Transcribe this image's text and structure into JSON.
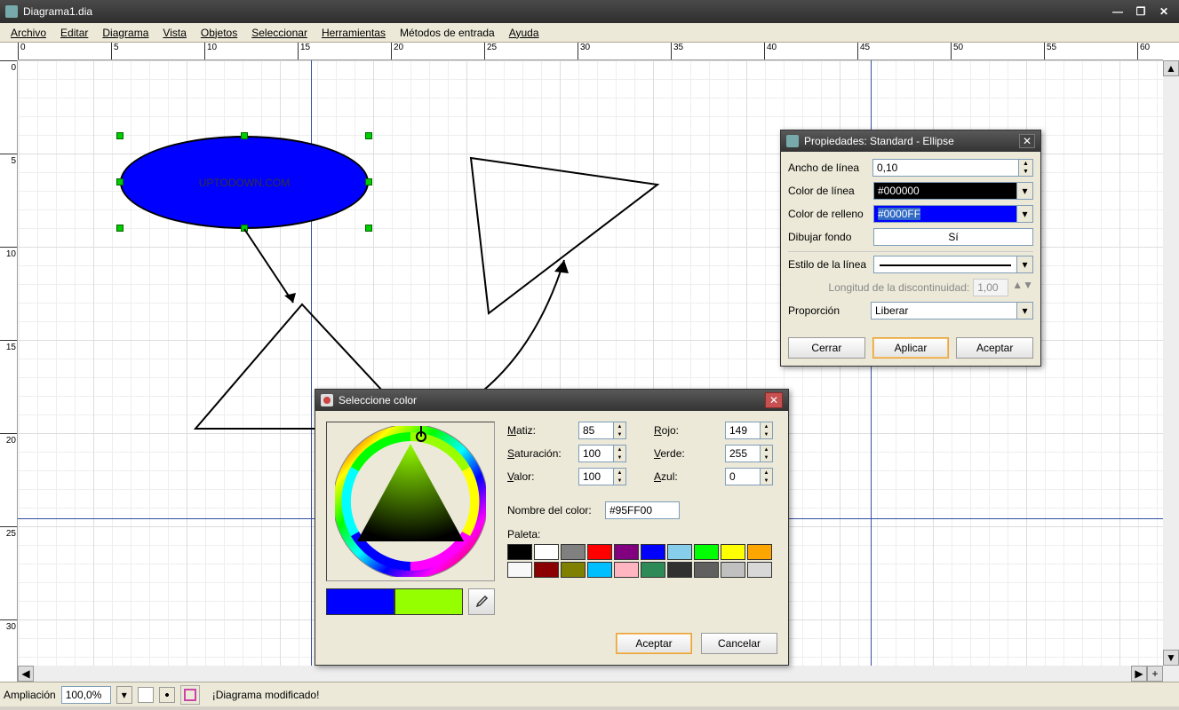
{
  "window": {
    "title": "Diagrama1.dia"
  },
  "menu": {
    "archivo": "Archivo",
    "editar": "Editar",
    "diagrama": "Diagrama",
    "vista": "Vista",
    "objetos": "Objetos",
    "seleccionar": "Seleccionar",
    "herramientas": "Herramientas",
    "metodos": "Métodos de entrada",
    "ayuda": "Ayuda"
  },
  "ruler_h": [
    "0",
    "5",
    "10",
    "15",
    "20",
    "25",
    "30",
    "35",
    "40",
    "45",
    "50",
    "55",
    "60"
  ],
  "ruler_v": [
    "0",
    "5",
    "10",
    "15",
    "20",
    "25",
    "30"
  ],
  "canvas": {
    "ellipse_text": "UPTODOWN.COM"
  },
  "status": {
    "zoom_label": "Ampliación",
    "zoom_value": "100,0%",
    "message": "¡Diagrama modificado!"
  },
  "props": {
    "title": "Propiedades: Standard - Ellipse",
    "rows": {
      "ancho_label": "Ancho de línea",
      "ancho_value": "0,10",
      "color_linea_label": "Color de línea",
      "color_linea_value": "#000000",
      "color_relleno_label": "Color de relleno",
      "color_relleno_value": "#0000FF",
      "dibujar_fondo_label": "Dibujar fondo",
      "dibujar_fondo_value": "Sí",
      "estilo_label": "Estilo de la línea",
      "longitud_label": "Longitud de la discontinuidad:",
      "longitud_value": "1,00",
      "proporcion_label": "Proporción",
      "proporcion_value": "Liberar"
    },
    "buttons": {
      "cerrar": "Cerrar",
      "aplicar": "Aplicar",
      "aceptar": "Aceptar"
    }
  },
  "color": {
    "title": "Seleccione color",
    "labels": {
      "matiz": "Matiz:",
      "saturacion": "Saturación:",
      "valor": "Valor:",
      "rojo": "Rojo:",
      "verde": "Verde:",
      "azul": "Azul:",
      "nombre": "Nombre del color:",
      "paleta": "Paleta:"
    },
    "values": {
      "matiz": "85",
      "saturacion": "100",
      "valor": "100",
      "rojo": "149",
      "verde": "255",
      "azul": "0",
      "nombre": "#95FF00"
    },
    "swatches": {
      "old": "#0000FF",
      "new": "#95FF00"
    },
    "palette": [
      "#000000",
      "#FFFFFF",
      "#808080",
      "#FF0000",
      "#800080",
      "#0000FF",
      "#87CEEB",
      "#00FF00",
      "#FFFF00",
      "#FFA500",
      "#F8F8F8",
      "#8B0000",
      "#808000",
      "#00BFFF",
      "#FFB6C1",
      "#2E8B57",
      "#303030",
      "#606060",
      "#C0C0C0",
      "#D8D8D8"
    ],
    "buttons": {
      "aceptar": "Aceptar",
      "cancelar": "Cancelar"
    }
  }
}
